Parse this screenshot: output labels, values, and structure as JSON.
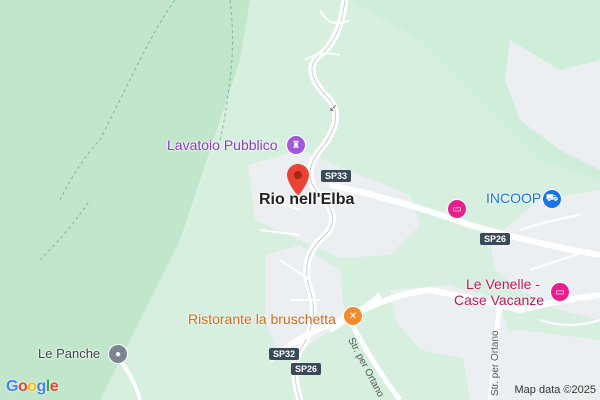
{
  "map": {
    "town": "Rio nell'Elba",
    "pois": {
      "lavatoio": "Lavatoio Pubblico",
      "incoop": "INCOOP",
      "venelle_line1": "Le Venelle -",
      "venelle_line2": "Case Vacanze",
      "ristorante": "Ristorante la bruschetta",
      "panche": "Le Panche"
    },
    "roads": {
      "sp33": "SP33",
      "sp26_right": "SP26",
      "sp32": "SP32",
      "sp26_bottom": "SP26",
      "str_ortano_1": "Str. per Ortano",
      "str_ortano_2": "Str. per Ortano"
    },
    "attribution": "Map data ©2025",
    "logo": "Google",
    "colors": {
      "vegetation": "#c8ead3",
      "urban": "#eceff1",
      "road": "#ffffff",
      "purple_poi": "#a259d9",
      "pink_poi": "#e91e8c",
      "blue_poi": "#1a73e8",
      "orange_poi": "#f08c2e",
      "pin": "#ea4335"
    },
    "icons": [
      "red-location-pin-icon",
      "tower-icon",
      "hotel-bed-icon",
      "shopping-cart-icon",
      "restaurant-icon",
      "landmark-icon"
    ]
  }
}
